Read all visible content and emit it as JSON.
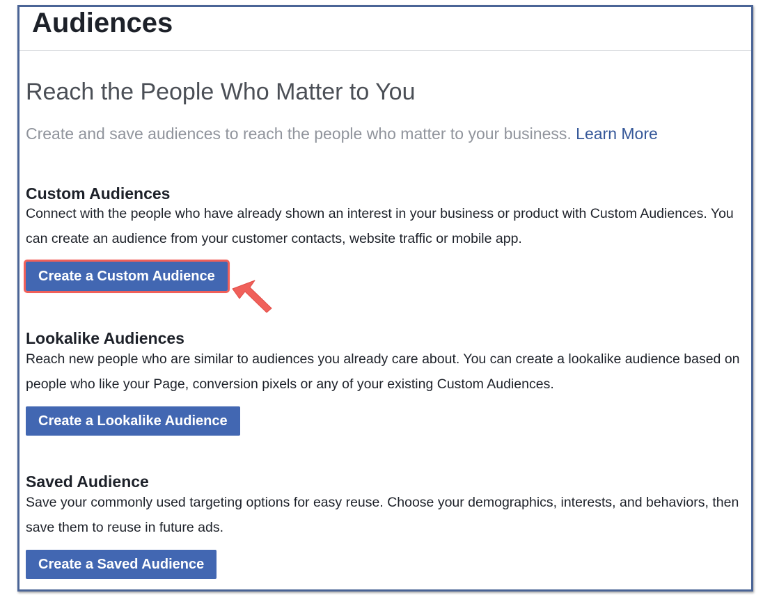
{
  "page": {
    "title": "Audiences"
  },
  "intro": {
    "headline": "Reach the People Who Matter to You",
    "subline": "Create and save audiences to reach the people who matter to your business.",
    "learn_more": "Learn More"
  },
  "sections": [
    {
      "title": "Custom Audiences",
      "description": "Connect with the people who have already shown an interest in your business or product with Custom Audiences. You can create an audience from your customer contacts, website traffic or mobile app.",
      "button": "Create a Custom Audience"
    },
    {
      "title": "Lookalike Audiences",
      "description": "Reach new people who are similar to audiences you already care about. You can create a lookalike audience based on people who like your Page, conversion pixels or any of your existing Custom Audiences.",
      "button": "Create a Lookalike Audience"
    },
    {
      "title": "Saved Audience",
      "description": "Save your commonly used targeting options for easy reuse. Choose your demographics, interests, and behaviors, then save them to reuse in future ads.",
      "button": "Create a Saved Audience"
    }
  ],
  "colors": {
    "button_blue": "#4267b2",
    "link_blue": "#365899",
    "highlight_red": "#f0605a",
    "frame_border": "#4a6496"
  },
  "icons": {
    "pointer": "arrow-pointer-icon"
  }
}
